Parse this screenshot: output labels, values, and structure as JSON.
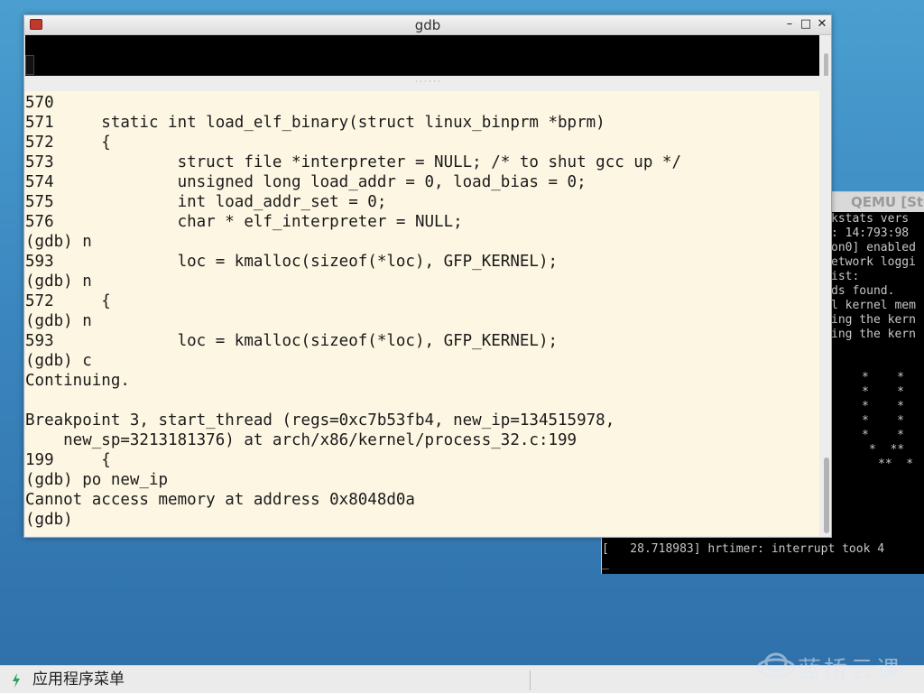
{
  "gdb_window": {
    "title": "gdb",
    "buttons": {
      "minimize": "–",
      "maximize": "□",
      "close": "✕"
    },
    "source_lines": [
      "570",
      "571     static int load_elf_binary(struct linux_binprm *bprm)",
      "572     {",
      "573             struct file *interpreter = NULL; /* to shut gcc up */",
      "574             unsigned long load_addr = 0, load_bias = 0;",
      "575             int load_addr_set = 0;",
      "576             char * elf_interpreter = NULL;",
      "(gdb) n",
      "593             loc = kmalloc(sizeof(*loc), GFP_KERNEL);",
      "(gdb) n",
      "572     {",
      "(gdb) n",
      "593             loc = kmalloc(sizeof(*loc), GFP_KERNEL);",
      "(gdb) c",
      "Continuing.",
      "",
      "Breakpoint 3, start_thread (regs=0xc7b53fb4, new_ip=134515978,",
      "    new_sp=3213181376) at arch/x86/kernel/process_32.c:199",
      "199     {",
      "(gdb) po new_ip",
      "Cannot access memory at address 0x8048d0a",
      "(gdb)"
    ]
  },
  "qemu_window": {
    "title": "QEMU [Sto",
    "screen_lines": [
      "kstats vers",
      ": 14:793:98",
      "on0] enabled",
      "etwork loggi",
      "ist:",
      "ds found.",
      "l kernel mem",
      "ing the kern",
      "ing the kern",
      "*    *",
      "*    *",
      "*    *",
      "*    *",
      "*    *",
      "*  **",
      "**  *",
      "[   28.718983] hrtimer: interrupt took 4",
      "_"
    ]
  },
  "taskbar": {
    "menu_label": "应用程序菜单"
  },
  "watermark": {
    "text": "蓝桥云课"
  }
}
